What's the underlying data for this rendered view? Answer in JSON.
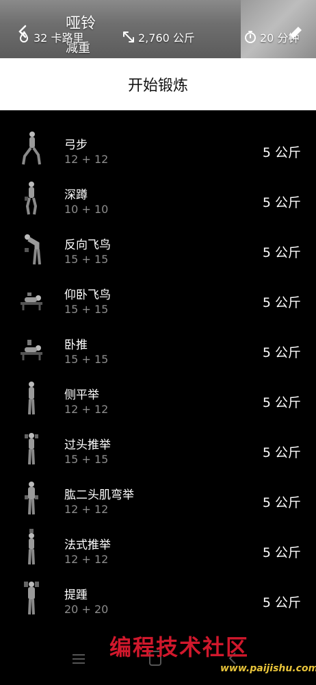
{
  "header": {
    "title": "哑铃",
    "subtitle": "减重",
    "calories": "32 卡路里",
    "volume": "2,760 公斤",
    "duration": "20 分钟"
  },
  "start_button": "开始锻炼",
  "exercises": [
    {
      "name": "弓步",
      "reps": "12 + 12",
      "weight": "5 公斤"
    },
    {
      "name": "深蹲",
      "reps": "10 + 10",
      "weight": "5 公斤"
    },
    {
      "name": "反向飞鸟",
      "reps": "15 + 15",
      "weight": "5 公斤"
    },
    {
      "name": "仰卧飞鸟",
      "reps": "15 + 15",
      "weight": "5 公斤"
    },
    {
      "name": "卧推",
      "reps": "15 + 15",
      "weight": "5 公斤"
    },
    {
      "name": "侧平举",
      "reps": "12 + 12",
      "weight": "5 公斤"
    },
    {
      "name": "过头推举",
      "reps": "15 + 15",
      "weight": "5 公斤"
    },
    {
      "name": "肱二头肌弯举",
      "reps": "12 + 12",
      "weight": "5 公斤"
    },
    {
      "name": "法式推举",
      "reps": "12 + 12",
      "weight": "5 公斤"
    },
    {
      "name": "提踵",
      "reps": "20 + 20",
      "weight": "5 公斤"
    }
  ],
  "watermark": {
    "text": "编程技术社区",
    "url": "www.paijishu.com"
  }
}
